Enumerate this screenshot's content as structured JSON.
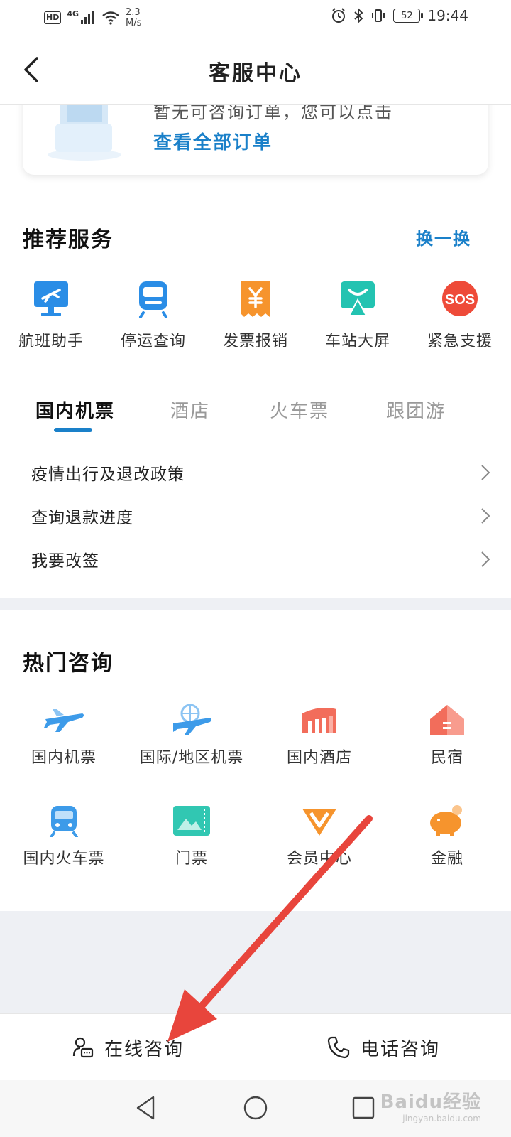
{
  "status_bar": {
    "hd": "HD",
    "signal": "4G",
    "net_speed_value": "2.3",
    "net_speed_unit": "M/s",
    "battery": "52",
    "time": "19:44"
  },
  "header": {
    "title": "客服中心"
  },
  "order_card": {
    "hint": "暂无可咨询订单，您可以点击",
    "link": "查看全部订单"
  },
  "recommended": {
    "title": "推荐服务",
    "swap": "换一换",
    "items": [
      {
        "label": "航班助手",
        "icon": "flight-monitor-icon"
      },
      {
        "label": "停运查询",
        "icon": "train-icon"
      },
      {
        "label": "发票报销",
        "icon": "invoice-yen-icon"
      },
      {
        "label": "车站大屏",
        "icon": "station-screen-icon"
      },
      {
        "label": "紧急支援",
        "icon": "sos-icon"
      }
    ]
  },
  "tabs": [
    {
      "label": "国内机票"
    },
    {
      "label": "酒店"
    },
    {
      "label": "火车票"
    },
    {
      "label": "跟团游"
    }
  ],
  "policy_list": [
    {
      "label": "疫情出行及退改政策"
    },
    {
      "label": "查询退款进度"
    },
    {
      "label": "我要改签"
    }
  ],
  "hot": {
    "title": "热门咨询",
    "items": [
      {
        "label": "国内机票"
      },
      {
        "label": "国际/地区机票"
      },
      {
        "label": "国内酒店"
      },
      {
        "label": "民宿"
      },
      {
        "label": "国内火车票"
      },
      {
        "label": "门票"
      },
      {
        "label": "会员中心"
      },
      {
        "label": "金融"
      }
    ]
  },
  "action_bar": {
    "online": "在线咨询",
    "phone": "电话咨询"
  },
  "watermark": {
    "main": "Baidu经验",
    "sub": "jingyan.baidu.com"
  },
  "colors": {
    "accent": "#1a80c9",
    "arrow": "#e8453c"
  }
}
